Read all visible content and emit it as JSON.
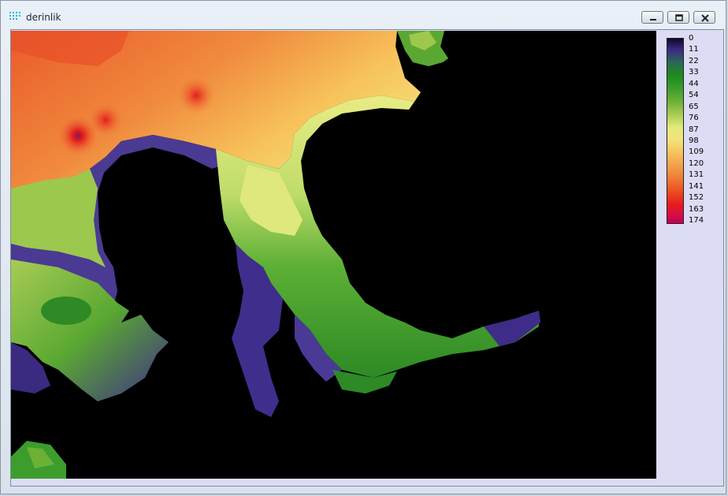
{
  "window": {
    "title": "derinlik",
    "icon": "dotted-grid-icon",
    "controls": {
      "minimize": "minimize-icon",
      "restore": "restore-icon",
      "close": "close-icon"
    }
  },
  "map": {
    "description_type": "bathymetry raster",
    "land_color": "#000000"
  },
  "legend": {
    "labels": [
      "0",
      "11",
      "22",
      "33",
      "44",
      "54",
      "65",
      "76",
      "87",
      "98",
      "109",
      "120",
      "131",
      "141",
      "152",
      "163",
      "174"
    ],
    "colors": [
      "#1a0f3a",
      "#3c2a84",
      "#3a7a3a",
      "#1e8a1e",
      "#3c9d2c",
      "#6cb035",
      "#a8cc55",
      "#e2ea7a",
      "#f4e27c",
      "#f7c25a",
      "#f2a04a",
      "#ef7a35",
      "#eb4b22",
      "#e51b1b",
      "#d80e48",
      "#c40057"
    ]
  }
}
